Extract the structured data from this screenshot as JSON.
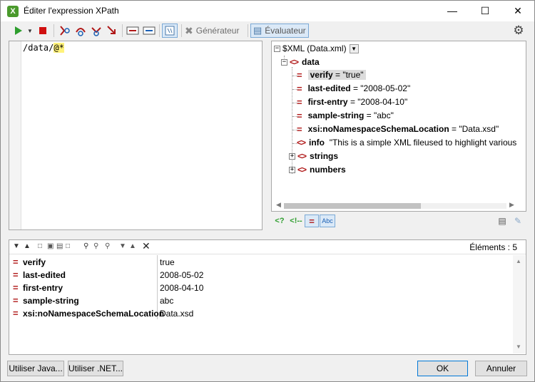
{
  "window": {
    "title": "Éditer l'expression XPath",
    "app_icon_glyph": "X"
  },
  "toolbar": {
    "generator_label": "Générateur",
    "evaluator_label": "Évaluateur"
  },
  "editor": {
    "expression_prefix": "/data/",
    "expression_highlight": "@*"
  },
  "tree": {
    "root_label": "$XML (Data.xml)",
    "element": "data",
    "attributes": [
      {
        "name": "verify",
        "value": "\"true\"",
        "selected": true
      },
      {
        "name": "last-edited",
        "value": "\"2008-05-02\""
      },
      {
        "name": "first-entry",
        "value": "\"2008-04-10\""
      },
      {
        "name": "sample-string",
        "value": "\"abc\""
      },
      {
        "name": "xsi:noNamespaceSchemaLocation",
        "value": "\"Data.xsd\""
      }
    ],
    "children": [
      {
        "name": "info",
        "value": "\"This is a simple XML fileused to highlight various",
        "expandable": false
      },
      {
        "name": "strings",
        "expandable": true
      },
      {
        "name": "numbers",
        "expandable": true
      }
    ]
  },
  "tree_toolbar": {
    "abc_label": "Abc"
  },
  "results": {
    "count_label": "Éléments : 5",
    "rows": [
      {
        "key": "verify",
        "value": "true"
      },
      {
        "key": "last-edited",
        "value": "2008-05-02"
      },
      {
        "key": "first-entry",
        "value": "2008-04-10"
      },
      {
        "key": "sample-string",
        "value": "abc"
      },
      {
        "key": "xsi:noNamespaceSchemaLocation",
        "value": "Data.xsd"
      }
    ]
  },
  "footer": {
    "java_button": "Utiliser Java...",
    "net_button": "Utiliser .NET...",
    "ok_button": "OK",
    "cancel_button": "Annuler"
  },
  "colors": {
    "accent": "#0078d7",
    "node_icon": "#b01818",
    "highlight": "#fff27a"
  }
}
